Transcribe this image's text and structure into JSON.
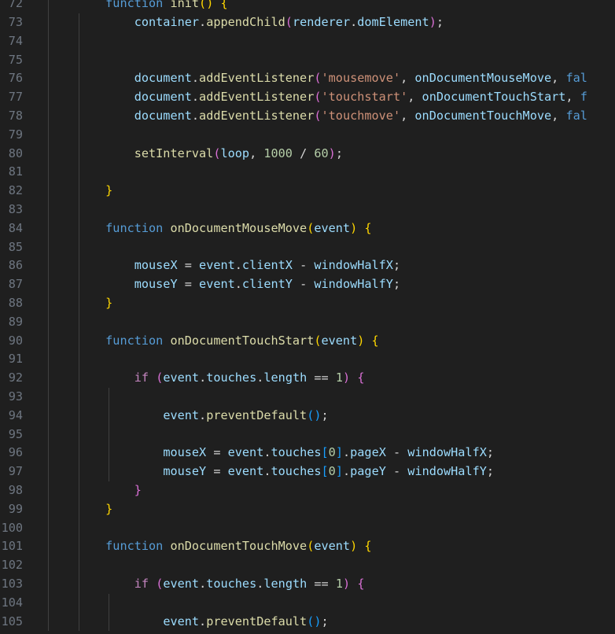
{
  "editor": {
    "colors": {
      "background": "#1f1f1f",
      "line_number": "#6e7681",
      "indent_guide": "#404040",
      "keyword": "#569cd6",
      "control": "#c586c0",
      "function": "#dcdcaa",
      "variable": "#9cdcfe",
      "string": "#ce9178",
      "number": "#b5cea8",
      "operator": "#d4d4d4",
      "bracket_1": "#ffd700",
      "bracket_2": "#da70d6",
      "bracket_3": "#179fff"
    },
    "lines": [
      {
        "num": "72",
        "tokens": [
          [
            "        ",
            "op"
          ],
          [
            "function",
            "kw"
          ],
          [
            " ",
            "op"
          ],
          [
            "init",
            "fn"
          ],
          [
            "()",
            "p1"
          ],
          [
            " ",
            "op"
          ],
          [
            "{",
            "p1"
          ]
        ]
      },
      {
        "num": "73",
        "tokens": [
          [
            "            ",
            "op"
          ],
          [
            "container",
            "var"
          ],
          [
            ".",
            "op"
          ],
          [
            "appendChild",
            "fn"
          ],
          [
            "(",
            "p2"
          ],
          [
            "renderer",
            "var"
          ],
          [
            ".",
            "op"
          ],
          [
            "domElement",
            "var"
          ],
          [
            ")",
            "p2"
          ],
          [
            ";",
            "op"
          ]
        ]
      },
      {
        "num": "74",
        "tokens": []
      },
      {
        "num": "75",
        "tokens": []
      },
      {
        "num": "76",
        "tokens": [
          [
            "            ",
            "op"
          ],
          [
            "document",
            "var"
          ],
          [
            ".",
            "op"
          ],
          [
            "addEventListener",
            "fn"
          ],
          [
            "(",
            "p2"
          ],
          [
            "'mousemove'",
            "str"
          ],
          [
            ", ",
            "op"
          ],
          [
            "onDocumentMouseMove",
            "var"
          ],
          [
            ", ",
            "op"
          ],
          [
            "fal",
            "kw"
          ]
        ]
      },
      {
        "num": "77",
        "tokens": [
          [
            "            ",
            "op"
          ],
          [
            "document",
            "var"
          ],
          [
            ".",
            "op"
          ],
          [
            "addEventListener",
            "fn"
          ],
          [
            "(",
            "p2"
          ],
          [
            "'touchstart'",
            "str"
          ],
          [
            ", ",
            "op"
          ],
          [
            "onDocumentTouchStart",
            "var"
          ],
          [
            ", ",
            "op"
          ],
          [
            "f",
            "kw"
          ]
        ]
      },
      {
        "num": "78",
        "tokens": [
          [
            "            ",
            "op"
          ],
          [
            "document",
            "var"
          ],
          [
            ".",
            "op"
          ],
          [
            "addEventListener",
            "fn"
          ],
          [
            "(",
            "p2"
          ],
          [
            "'touchmove'",
            "str"
          ],
          [
            ", ",
            "op"
          ],
          [
            "onDocumentTouchMove",
            "var"
          ],
          [
            ", ",
            "op"
          ],
          [
            "fal",
            "kw"
          ]
        ]
      },
      {
        "num": "79",
        "tokens": []
      },
      {
        "num": "80",
        "tokens": [
          [
            "            ",
            "op"
          ],
          [
            "setInterval",
            "fn"
          ],
          [
            "(",
            "p2"
          ],
          [
            "loop",
            "var"
          ],
          [
            ", ",
            "op"
          ],
          [
            "1000",
            "num"
          ],
          [
            " / ",
            "op"
          ],
          [
            "60",
            "num"
          ],
          [
            ")",
            "p2"
          ],
          [
            ";",
            "op"
          ]
        ]
      },
      {
        "num": "81",
        "tokens": []
      },
      {
        "num": "82",
        "tokens": [
          [
            "        ",
            "op"
          ],
          [
            "}",
            "p1"
          ]
        ]
      },
      {
        "num": "83",
        "tokens": []
      },
      {
        "num": "84",
        "tokens": [
          [
            "        ",
            "op"
          ],
          [
            "function",
            "kw"
          ],
          [
            " ",
            "op"
          ],
          [
            "onDocumentMouseMove",
            "fn"
          ],
          [
            "(",
            "p1"
          ],
          [
            "event",
            "var"
          ],
          [
            ")",
            "p1"
          ],
          [
            " ",
            "op"
          ],
          [
            "{",
            "p1"
          ]
        ]
      },
      {
        "num": "85",
        "tokens": []
      },
      {
        "num": "86",
        "tokens": [
          [
            "            ",
            "op"
          ],
          [
            "mouseX",
            "var"
          ],
          [
            " = ",
            "op"
          ],
          [
            "event",
            "var"
          ],
          [
            ".",
            "op"
          ],
          [
            "clientX",
            "var"
          ],
          [
            " - ",
            "op"
          ],
          [
            "windowHalfX",
            "var"
          ],
          [
            ";",
            "op"
          ]
        ]
      },
      {
        "num": "87",
        "tokens": [
          [
            "            ",
            "op"
          ],
          [
            "mouseY",
            "var"
          ],
          [
            " = ",
            "op"
          ],
          [
            "event",
            "var"
          ],
          [
            ".",
            "op"
          ],
          [
            "clientY",
            "var"
          ],
          [
            " - ",
            "op"
          ],
          [
            "windowHalfY",
            "var"
          ],
          [
            ";",
            "op"
          ]
        ]
      },
      {
        "num": "88",
        "tokens": [
          [
            "        ",
            "op"
          ],
          [
            "}",
            "p1"
          ]
        ]
      },
      {
        "num": "89",
        "tokens": []
      },
      {
        "num": "90",
        "tokens": [
          [
            "        ",
            "op"
          ],
          [
            "function",
            "kw"
          ],
          [
            " ",
            "op"
          ],
          [
            "onDocumentTouchStart",
            "fn"
          ],
          [
            "(",
            "p1"
          ],
          [
            "event",
            "var"
          ],
          [
            ")",
            "p1"
          ],
          [
            " ",
            "op"
          ],
          [
            "{",
            "p1"
          ]
        ]
      },
      {
        "num": "91",
        "tokens": []
      },
      {
        "num": "92",
        "tokens": [
          [
            "            ",
            "op"
          ],
          [
            "if",
            "ctl"
          ],
          [
            " ",
            "op"
          ],
          [
            "(",
            "p2"
          ],
          [
            "event",
            "var"
          ],
          [
            ".",
            "op"
          ],
          [
            "touches",
            "var"
          ],
          [
            ".",
            "op"
          ],
          [
            "length",
            "var"
          ],
          [
            " == ",
            "op"
          ],
          [
            "1",
            "num"
          ],
          [
            ")",
            "p2"
          ],
          [
            " ",
            "op"
          ],
          [
            "{",
            "p2"
          ]
        ]
      },
      {
        "num": "93",
        "tokens": []
      },
      {
        "num": "94",
        "tokens": [
          [
            "                ",
            "op"
          ],
          [
            "event",
            "var"
          ],
          [
            ".",
            "op"
          ],
          [
            "preventDefault",
            "fn"
          ],
          [
            "()",
            "p3"
          ],
          [
            ";",
            "op"
          ]
        ]
      },
      {
        "num": "95",
        "tokens": []
      },
      {
        "num": "96",
        "tokens": [
          [
            "                ",
            "op"
          ],
          [
            "mouseX",
            "var"
          ],
          [
            " = ",
            "op"
          ],
          [
            "event",
            "var"
          ],
          [
            ".",
            "op"
          ],
          [
            "touches",
            "var"
          ],
          [
            "[",
            "p3"
          ],
          [
            "0",
            "num"
          ],
          [
            "]",
            "p3"
          ],
          [
            ".",
            "op"
          ],
          [
            "pageX",
            "var"
          ],
          [
            " - ",
            "op"
          ],
          [
            "windowHalfX",
            "var"
          ],
          [
            ";",
            "op"
          ]
        ]
      },
      {
        "num": "97",
        "tokens": [
          [
            "                ",
            "op"
          ],
          [
            "mouseY",
            "var"
          ],
          [
            " = ",
            "op"
          ],
          [
            "event",
            "var"
          ],
          [
            ".",
            "op"
          ],
          [
            "touches",
            "var"
          ],
          [
            "[",
            "p3"
          ],
          [
            "0",
            "num"
          ],
          [
            "]",
            "p3"
          ],
          [
            ".",
            "op"
          ],
          [
            "pageY",
            "var"
          ],
          [
            " - ",
            "op"
          ],
          [
            "windowHalfY",
            "var"
          ],
          [
            ";",
            "op"
          ]
        ]
      },
      {
        "num": "98",
        "tokens": [
          [
            "            ",
            "op"
          ],
          [
            "}",
            "p2"
          ]
        ]
      },
      {
        "num": "99",
        "tokens": [
          [
            "        ",
            "op"
          ],
          [
            "}",
            "p1"
          ]
        ]
      },
      {
        "num": "100",
        "tokens": []
      },
      {
        "num": "101",
        "tokens": [
          [
            "        ",
            "op"
          ],
          [
            "function",
            "kw"
          ],
          [
            " ",
            "op"
          ],
          [
            "onDocumentTouchMove",
            "fn"
          ],
          [
            "(",
            "p1"
          ],
          [
            "event",
            "var"
          ],
          [
            ")",
            "p1"
          ],
          [
            " ",
            "op"
          ],
          [
            "{",
            "p1"
          ]
        ]
      },
      {
        "num": "102",
        "tokens": []
      },
      {
        "num": "103",
        "tokens": [
          [
            "            ",
            "op"
          ],
          [
            "if",
            "ctl"
          ],
          [
            " ",
            "op"
          ],
          [
            "(",
            "p2"
          ],
          [
            "event",
            "var"
          ],
          [
            ".",
            "op"
          ],
          [
            "touches",
            "var"
          ],
          [
            ".",
            "op"
          ],
          [
            "length",
            "var"
          ],
          [
            " == ",
            "op"
          ],
          [
            "1",
            "num"
          ],
          [
            ")",
            "p2"
          ],
          [
            " ",
            "op"
          ],
          [
            "{",
            "p2"
          ]
        ]
      },
      {
        "num": "104",
        "tokens": []
      },
      {
        "num": "105",
        "tokens": [
          [
            "                ",
            "op"
          ],
          [
            "event",
            "var"
          ],
          [
            ".",
            "op"
          ],
          [
            "preventDefault",
            "fn"
          ],
          [
            "()",
            "p3"
          ],
          [
            ";",
            "op"
          ]
        ]
      }
    ]
  }
}
